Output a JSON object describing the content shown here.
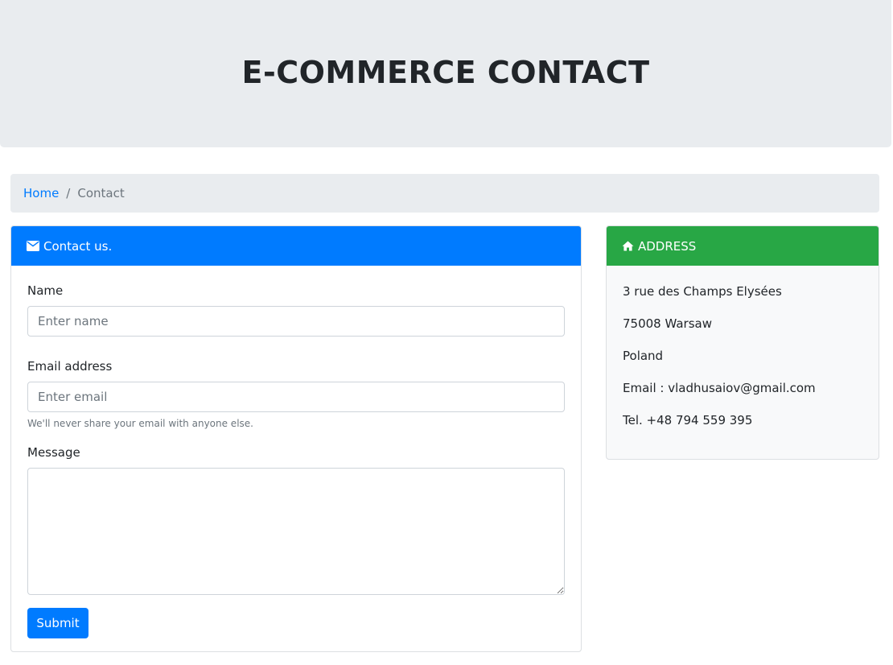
{
  "page": {
    "title": "E-COMMERCE CONTACT"
  },
  "breadcrumb": {
    "home": "Home",
    "separator": "/",
    "current": "Contact"
  },
  "contact_card": {
    "header": "Contact us.",
    "icon": "envelope-icon",
    "name_label": "Name",
    "name_placeholder": "Enter name",
    "email_label": "Email address",
    "email_placeholder": "Enter email",
    "email_help": "We'll never share your email with anyone else.",
    "message_label": "Message",
    "submit_label": "Submit"
  },
  "address_card": {
    "header": "ADDRESS",
    "icon": "home-icon",
    "lines": [
      "3 rue des Champs Elysées",
      "75008 Warsaw",
      "Poland",
      "Email : vladhusaiov@gmail.com",
      "Tel. +48 794 559 395"
    ]
  },
  "colors": {
    "primary": "#007bff",
    "success": "#28a745",
    "jumbotron": "#e9ecef",
    "address_bg": "#f8f9fa"
  }
}
